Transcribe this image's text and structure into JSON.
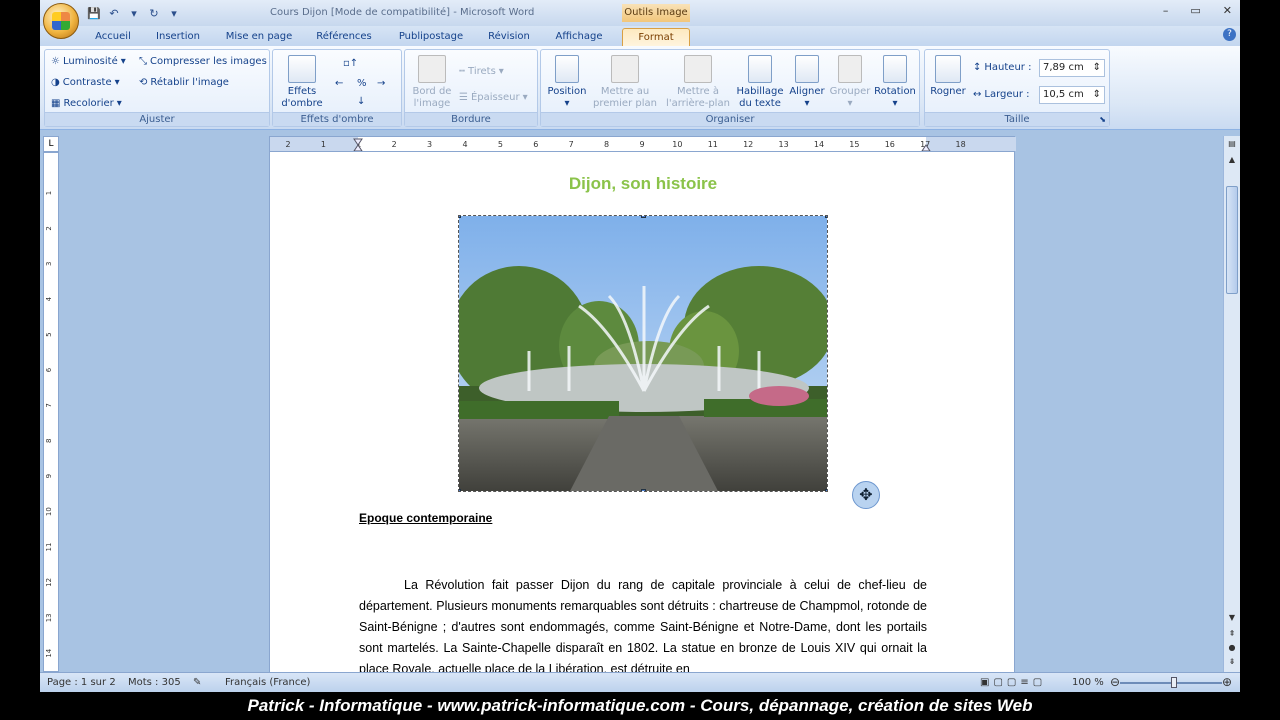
{
  "window": {
    "title": "Cours Dijon [Mode de compatibilité] - Microsoft Word",
    "context_tab": "Outils Image",
    "controls": [
      "–",
      "▭",
      "✕"
    ]
  },
  "tabs": [
    "Accueil",
    "Insertion",
    "Mise en page",
    "Références",
    "Publipostage",
    "Révision",
    "Affichage",
    "Format"
  ],
  "active_tab": "Format",
  "ribbon": {
    "ajuster": {
      "title": "Ajuster",
      "luminosite": "Luminosité",
      "contraste": "Contraste",
      "recolorier": "Recolorier",
      "compresser": "Compresser les images",
      "retablir": "Rétablir l'image"
    },
    "effets": {
      "title": "Effets d'ombre",
      "button_line1": "Effets",
      "button_line2": "d'ombre"
    },
    "bordure": {
      "title": "Bordure",
      "bord_line1": "Bord de",
      "bord_line2": "l'image",
      "tirets": "Tirets",
      "epaisseur": "Épaisseur"
    },
    "organiser": {
      "title": "Organiser",
      "position": "Position",
      "premier_line1": "Mettre au",
      "premier_line2": "premier plan",
      "arriere_line1": "Mettre à",
      "arriere_line2": "l'arrière-plan",
      "habillage_line1": "Habillage",
      "habillage_line2": "du texte",
      "aligner": "Aligner",
      "grouper": "Grouper",
      "rotation": "Rotation"
    },
    "taille": {
      "title": "Taille",
      "rogner": "Rogner",
      "hauteur_label": "Hauteur :",
      "hauteur_value": "7,89 cm",
      "largeur_label": "Largeur :",
      "largeur_value": "10,5 cm"
    }
  },
  "ruler": {
    "tab_selector": "L",
    "ticks": [
      "2",
      "1",
      "1",
      "2",
      "3",
      "4",
      "5",
      "6",
      "7",
      "8",
      "9",
      "10",
      "11",
      "12",
      "13",
      "14",
      "15",
      "16",
      "17",
      "18"
    ],
    "v_ticks": [
      "1",
      "2",
      "3",
      "4",
      "5",
      "6",
      "7",
      "8",
      "9",
      "10",
      "11",
      "12",
      "13",
      "14"
    ]
  },
  "document": {
    "title": "Dijon, son histoire",
    "section_heading": "Epoque contemporaine",
    "paragraph": "La Révolution fait passer Dijon du rang de capitale provinciale à celui de chef-lieu de département. Plusieurs monuments remarquables sont détruits : chartreuse de Champmol, rotonde de Saint-Bénigne ; d'autres sont endommagés, comme Saint-Bénigne et Notre-Dame, dont les portails sont martelés. La Sainte-Chapelle disparaît en 1802. La statue en bronze de Louis XIV qui ornait la place Royale, actuelle place de la Libération, est détruite en"
  },
  "statusbar": {
    "page": "Page : 1 sur 2",
    "words": "Mots : 305",
    "language": "Français (France)",
    "zoom": "100 %"
  },
  "footer": "Patrick - Informatique - www.patrick-informatique.com - Cours, dépannage, création de sites Web",
  "colors": {
    "title_green": "#8bc34a",
    "ribbon_blue": "#15428b",
    "active_tab": "#fde9c0"
  }
}
